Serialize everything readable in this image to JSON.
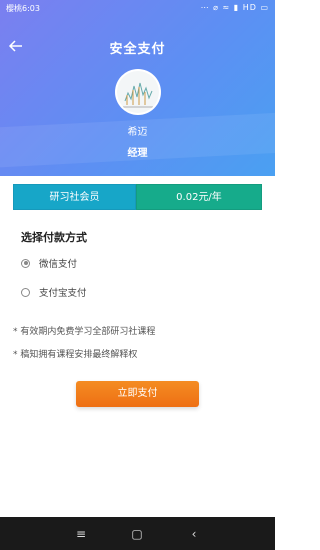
{
  "status_bar": {
    "carrier_time": "樱桃6:03",
    "right_icons": "⋯ ⌀ ≈ ▮ HD ▭"
  },
  "header": {
    "back_icon": "arrow-left-icon",
    "title": "安全支付"
  },
  "user": {
    "name": "希迈",
    "role": "经理"
  },
  "plan": {
    "name": "研习社会员",
    "price": "0.02元/年"
  },
  "payment": {
    "section_title": "选择付款方式",
    "options": [
      {
        "label": "微信支付",
        "selected": true
      },
      {
        "label": "支付宝支付",
        "selected": false
      }
    ]
  },
  "notes": [
    "* 有效期内免费学习全部研习社课程",
    "* 稿知拥有课程安排最终解释权"
  ],
  "pay_button": {
    "label": "立即支付"
  },
  "nav": {
    "menu_icon": "≡",
    "home_icon": "▢",
    "back_icon": "‹"
  },
  "colors": {
    "header_start": "#7b7ff0",
    "header_end": "#4aa0f2",
    "plan_name_bg": "#17a6c8",
    "plan_price_bg": "#16ab8b",
    "pay_button": "#f07a18"
  }
}
